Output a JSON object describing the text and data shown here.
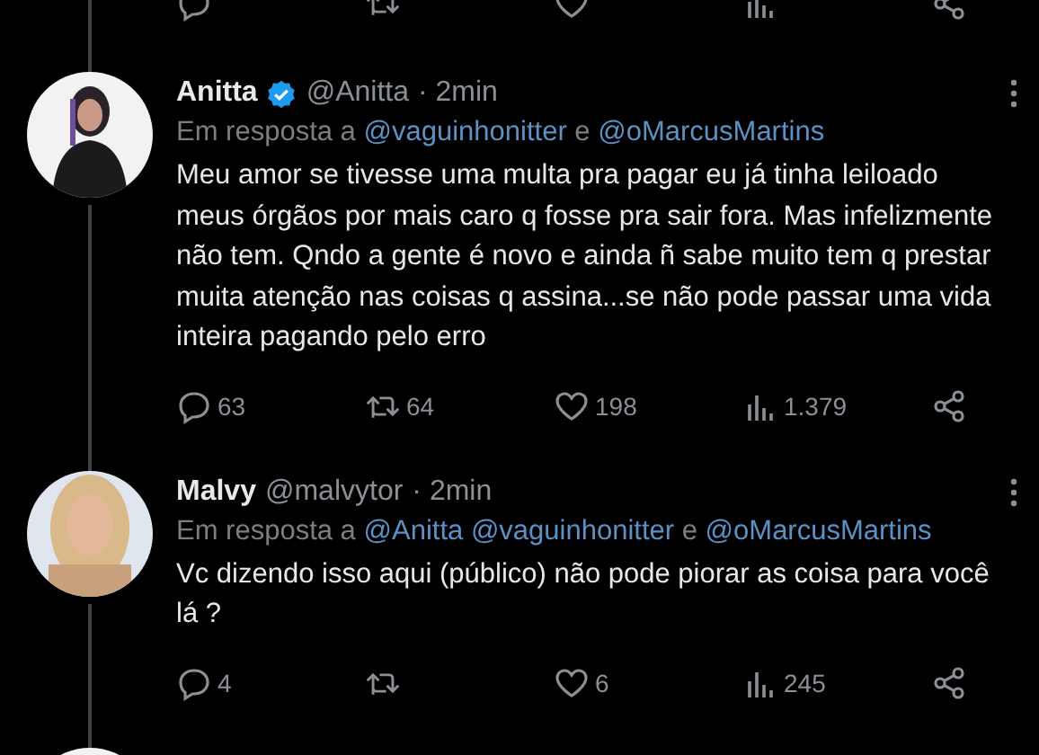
{
  "previous_tweet": {
    "actions": [
      {
        "kind": "reply"
      },
      {
        "kind": "retweet"
      },
      {
        "kind": "like"
      },
      {
        "kind": "views"
      },
      {
        "kind": "share"
      }
    ]
  },
  "tweets": [
    {
      "name": "Anitta",
      "verified": true,
      "handle": "@Anitta",
      "time": "· 2min",
      "in_reply_to": [
        {
          "kind": "plain",
          "text": "Em resposta a"
        },
        {
          "kind": "mention",
          "text": "@vaguinhonitter"
        },
        {
          "kind": "plain",
          "text": "e"
        },
        {
          "kind": "mention",
          "text": "@oMarcusMartins"
        }
      ],
      "body": "Meu amor se tivesse uma multa pra pagar eu já tinha leiloado meus órgãos por mais caro q fosse pra sair fora. Mas infelizmente não tem. Qndo a gente é novo e ainda ñ sabe muito tem q prestar muita atenção nas coisas q assina...se não pode passar uma vida inteira pagando pelo erro",
      "avatar": {
        "kind": "picture"
      },
      "actions": [
        {
          "kind": "reply",
          "count": "63"
        },
        {
          "kind": "retweet",
          "count": "64"
        },
        {
          "kind": "like",
          "count": "198"
        },
        {
          "kind": "views",
          "count": "1.379"
        },
        {
          "kind": "share"
        }
      ]
    },
    {
      "name": "Malvy",
      "verified": false,
      "handle": "@malvytor",
      "time": "· 2min",
      "in_reply_to": [
        {
          "kind": "plain",
          "text": "Em resposta a"
        },
        {
          "kind": "mention",
          "text": "@Anitta"
        },
        {
          "kind": "mention",
          "text": "@vaguinhonitter"
        },
        {
          "kind": "plain",
          "text": "e"
        },
        {
          "kind": "mention",
          "text": "@oMarcusMartins"
        }
      ],
      "body": "Vc dizendo isso aqui (público) não pode piorar as coisa para você lá ?",
      "avatar": {
        "kind": "picture"
      },
      "actions": [
        {
          "kind": "reply",
          "count": "4"
        },
        {
          "kind": "retweet"
        },
        {
          "kind": "like",
          "count": "6"
        },
        {
          "kind": "views",
          "count": "245"
        },
        {
          "kind": "share"
        }
      ]
    }
  ],
  "next_tweet": {
    "avatar": {
      "kind": "picture"
    }
  }
}
